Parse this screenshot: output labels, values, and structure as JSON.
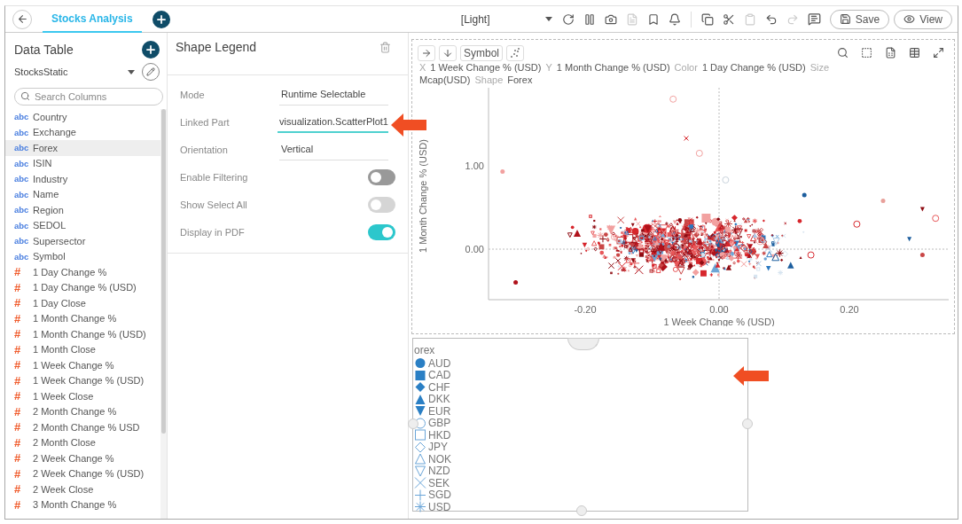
{
  "tab": {
    "label": "Stocks Analysis",
    "selected": true
  },
  "toolbar": {
    "theme": "[Light]",
    "save": "Save",
    "view": "View"
  },
  "data_table": {
    "title": "Data Table",
    "source": "StocksStatic",
    "search": {
      "placeholder": "Search Columns"
    },
    "columns": [
      {
        "type": "abc",
        "name": "Country",
        "selected": false
      },
      {
        "type": "abc",
        "name": "Exchange",
        "selected": false
      },
      {
        "type": "abc",
        "name": "Forex",
        "selected": true
      },
      {
        "type": "abc",
        "name": "ISIN",
        "selected": false
      },
      {
        "type": "abc",
        "name": "Industry",
        "selected": false
      },
      {
        "type": "abc",
        "name": "Name",
        "selected": false
      },
      {
        "type": "abc",
        "name": "Region",
        "selected": false
      },
      {
        "type": "abc",
        "name": "SEDOL",
        "selected": false
      },
      {
        "type": "abc",
        "name": "Supersector",
        "selected": false
      },
      {
        "type": "abc",
        "name": "Symbol",
        "selected": false
      },
      {
        "type": "#",
        "name": "1 Day Change %",
        "selected": false
      },
      {
        "type": "#",
        "name": "1 Day Change % (USD)",
        "selected": false
      },
      {
        "type": "#",
        "name": "1 Day Close",
        "selected": false
      },
      {
        "type": "#",
        "name": "1 Month Change %",
        "selected": false
      },
      {
        "type": "#",
        "name": "1 Month Change % (USD)",
        "selected": false
      },
      {
        "type": "#",
        "name": "1 Month Close",
        "selected": false
      },
      {
        "type": "#",
        "name": "1 Week Change %",
        "selected": false
      },
      {
        "type": "#",
        "name": "1 Week Change % (USD)",
        "selected": false
      },
      {
        "type": "#",
        "name": "1 Week Close",
        "selected": false
      },
      {
        "type": "#",
        "name": "2 Month Change %",
        "selected": false
      },
      {
        "type": "#",
        "name": "2 Month Change % USD",
        "selected": false
      },
      {
        "type": "#",
        "name": "2 Month Close",
        "selected": false
      },
      {
        "type": "#",
        "name": "2 Week Change %",
        "selected": false
      },
      {
        "type": "#",
        "name": "2 Week Change % (USD)",
        "selected": false
      },
      {
        "type": "#",
        "name": "2 Week Close",
        "selected": false
      },
      {
        "type": "#",
        "name": "3 Month Change %",
        "selected": false
      }
    ]
  },
  "properties": {
    "title": "Shape Legend",
    "fields": [
      {
        "kind": "text",
        "label": "Mode",
        "value": "Runtime Selectable",
        "focused": false
      },
      {
        "kind": "text",
        "label": "Linked Part",
        "value": "visualization.ScatterPlot1",
        "focused": true
      },
      {
        "kind": "text",
        "label": "Orientation",
        "value": "Vertical",
        "focused": false
      },
      {
        "kind": "toggle",
        "label": "Enable Filtering",
        "on": false,
        "disabled": false
      },
      {
        "kind": "toggle",
        "label": "Show Select All",
        "on": false,
        "disabled": true
      },
      {
        "kind": "toggle",
        "label": "Display in PDF",
        "on": true,
        "disabled": false
      }
    ]
  },
  "plot": {
    "symbol_button": "Symbol",
    "mappings": [
      {
        "role": "X",
        "value": "1 Week Change % (USD)"
      },
      {
        "role": "Y",
        "value": "1 Month Change % (USD)"
      },
      {
        "role": "Color",
        "value": "1 Day Change % (USD)"
      },
      {
        "role": "Size",
        "value": "Mcap(USD)"
      },
      {
        "role": "Shape",
        "value": "Forex"
      }
    ],
    "ylabel": "1 Month Change % (USD)",
    "xlabel": "1 Week Change % (USD)",
    "xticks": [
      "-0.20",
      "0.00",
      "0.20"
    ],
    "yticks": [
      "1.00",
      "0.00"
    ]
  },
  "legend": {
    "title": "orex",
    "items": [
      {
        "label": "AUD",
        "kind": "circle"
      },
      {
        "label": "CAD",
        "kind": "square"
      },
      {
        "label": "CHF",
        "kind": "diamond"
      },
      {
        "label": "DKK",
        "kind": "triangle"
      },
      {
        "label": "EUR",
        "kind": "triangle-down"
      },
      {
        "label": "GBP",
        "kind": "circle-open"
      },
      {
        "label": "HKD",
        "kind": "square-open"
      },
      {
        "label": "JPY",
        "kind": "diamond-open"
      },
      {
        "label": "NOK",
        "kind": "triangle-open"
      },
      {
        "label": "NZD",
        "kind": "triangle-down-open"
      },
      {
        "label": "SEK",
        "kind": "cross"
      },
      {
        "label": "SGD",
        "kind": "plus"
      },
      {
        "label": "USD",
        "kind": "asterisk"
      }
    ]
  }
}
